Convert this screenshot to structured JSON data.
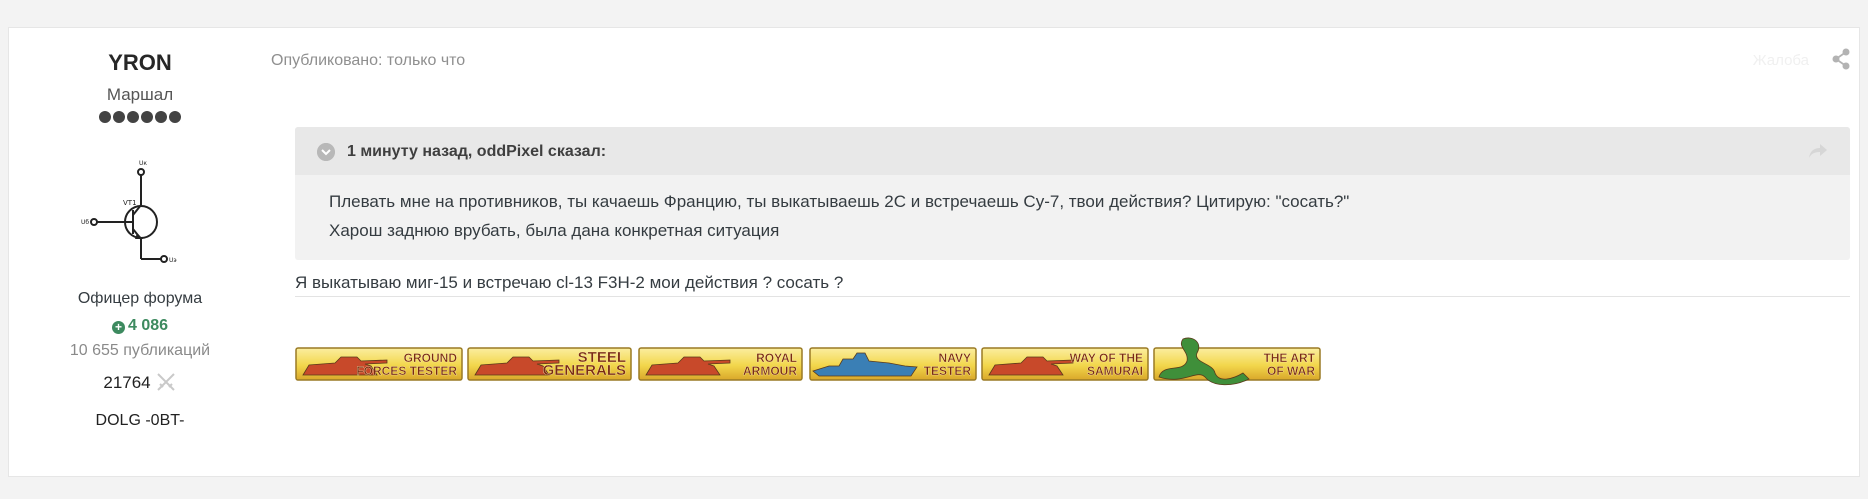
{
  "author": {
    "name": "YRON",
    "rank": "Маршал",
    "rank_pips": 6,
    "avatar_icon": "transistor-diagram-avatar",
    "group": "Офицер форума",
    "reputation": "4 086",
    "posts": "10 655 публикаций",
    "battles": "21764",
    "clan": "DOLG -0BT-"
  },
  "post": {
    "meta": "Опубликовано: только что",
    "report_label": "Жалоба",
    "quote": {
      "cite": "1 минуту назад, oddPixel сказал:",
      "paragraphs": [
        "Плевать мне на противников, ты качаешь Францию, ты выкатываешь 2С и встречаешь Су-7, твои действия? Цитирую: \"сосать?\"",
        "Харош заднюю врубать, была дана конкретная ситуация"
      ]
    },
    "reply": "Я выкатываю миг-15 и встречаю cl-13 F3H-2 мои действия ? сосать ?"
  },
  "signature": {
    "badges": [
      {
        "line1": "GROUND",
        "line2": "FORCES TESTER",
        "icon": "tank-icon",
        "icon_color": "#c8492a"
      },
      {
        "line1": "STEEL",
        "line2": "GENERALS",
        "icon": "tank-icon",
        "icon_color": "#c8492a"
      },
      {
        "line1": "ROYAL",
        "line2": "ARMOUR",
        "icon": "tank-icon",
        "icon_color": "#c8492a"
      },
      {
        "line1": "NAVY",
        "line2": "TESTER",
        "icon": "ship-icon",
        "icon_color": "#3a7fb5"
      },
      {
        "line1": "WAY OF THE",
        "line2": "SAMURAI",
        "icon": "tank-icon",
        "icon_color": "#c8492a"
      },
      {
        "line1": "THE ART",
        "line2": "OF WAR",
        "icon": "dragon-icon",
        "icon_color": "#3f8f3a"
      }
    ]
  },
  "colors": {
    "reputation": "#3d8a5f",
    "quote_bg": "#f2f2f2",
    "quote_header_bg": "#e8e8e8",
    "badge_yellow": "#f2d64b"
  }
}
